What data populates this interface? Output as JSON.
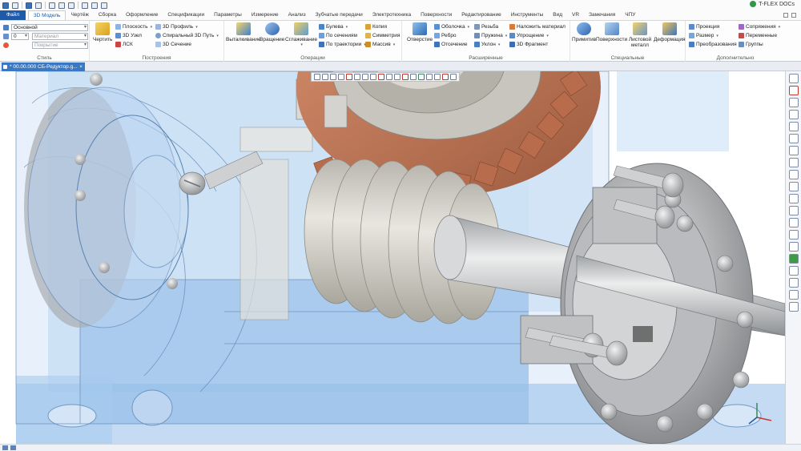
{
  "quick_access": {
    "icons": [
      "new-document-icon",
      "open-icon",
      "save-icon",
      "undo-icon",
      "redo-icon",
      "print-icon",
      "import-icon"
    ]
  },
  "docs_badge": {
    "label": "T-FLEX DOCs"
  },
  "tabs": [
    {
      "label": "Файл",
      "kind": "file"
    },
    {
      "label": "3D Модель",
      "kind": "active"
    },
    {
      "label": "Чертёж"
    },
    {
      "label": "Сборка"
    },
    {
      "label": "Оформление"
    },
    {
      "label": "Спецификации"
    },
    {
      "label": "Параметры"
    },
    {
      "label": "Измерение"
    },
    {
      "label": "Анализ"
    },
    {
      "label": "Зубчатые передачи"
    },
    {
      "label": "Электротехника"
    },
    {
      "label": "Поверхности"
    },
    {
      "label": "Редактирование"
    },
    {
      "label": "Инструменты"
    },
    {
      "label": "Вид"
    },
    {
      "label": "VR"
    },
    {
      "label": "Замечания"
    },
    {
      "label": "ЧПУ"
    }
  ],
  "ribbon": {
    "style": {
      "title": "Стиль",
      "style_value": "Основной",
      "layer_value": "0",
      "material_placeholder": "Материал",
      "coating_placeholder": "Покрытие"
    },
    "constructions": {
      "title": "Построения",
      "draw": "Чертить",
      "plane": "Плоскость",
      "node3d": "3D Узел",
      "lsk": "ЛСК",
      "profile3d": "3D Профиль",
      "spiral_path": "Спиральный 3D Путь",
      "section3d": "3D Сечение"
    },
    "operations": {
      "title": "Операции",
      "extrude": "Выталкивание",
      "revolve": "Вращение",
      "smooth": "Сглаживание",
      "boolean": "Булева",
      "by_sections": "По сечениям",
      "by_path": "По траектории",
      "copy": "Копия",
      "symmetry": "Симметрия",
      "array": "Массив"
    },
    "extended": {
      "title": "Расширенные",
      "hole": "Отверстие",
      "shell": "Оболочка",
      "rib": "Ребро",
      "cut": "Отсечение",
      "thread": "Резьба",
      "spring": "Пружина",
      "slope": "Уклон",
      "apply_material": "Наложить материал",
      "simplify": "Упрощение",
      "fragment3d": "3D Фрагмент"
    },
    "special": {
      "title": "Специальные",
      "primitive": "Примитив",
      "surfaces": "Поверхности",
      "sheet_metal": "Листовой металл",
      "deformation": "Деформация"
    },
    "additional": {
      "title": "Дополнительно",
      "projection": "Проекция",
      "size": "Размер",
      "transforms": "Преобразования",
      "mates": "Сопряжения",
      "variables": "Переменные",
      "groups": "Группы"
    }
  },
  "document_tab": {
    "label": "* 00.00.000 СБ-Редуктор.g..."
  },
  "colors": {
    "file_tab": "#1f5aa8",
    "housing_transparent": "#7aaee0",
    "worm_wheel": "#c0795a",
    "steel": "#c7c9cb",
    "doc_tab": "#3b78c4"
  }
}
